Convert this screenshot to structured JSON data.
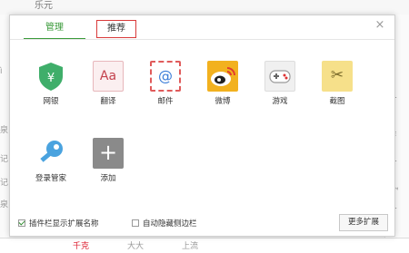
{
  "background": {
    "top_text": "乐元",
    "left_fragments": [
      "ì",
      "泉",
      "记",
      "记",
      "泉"
    ],
    "right_fragments": [
      "‹",
      "T",
      "¥",
      "T",
      "™",
      "T"
    ],
    "bottom_fragments": [
      "千克",
      "大大",
      "上流"
    ]
  },
  "dialog": {
    "tabs": [
      {
        "label": "管理"
      },
      {
        "label": "推荐"
      }
    ],
    "close_glyph": "×",
    "extensions": [
      {
        "name": "网银",
        "icon": "shield-icon",
        "color": "#3fae6a",
        "glyph": "¥"
      },
      {
        "name": "翻译",
        "icon": "translate-icon",
        "color": "#e7e7e7",
        "glyph": "Aa"
      },
      {
        "name": "邮件",
        "icon": "mail-icon",
        "color": "#ffffff",
        "glyph": "@"
      },
      {
        "name": "微博",
        "icon": "weibo-icon",
        "color": "#f2b11f",
        "glyph": ""
      },
      {
        "name": "游戏",
        "icon": "gamepad-icon",
        "color": "#eeeeee",
        "glyph": ""
      },
      {
        "name": "截图",
        "icon": "screenshot-icon",
        "color": "#f6e08a",
        "glyph": "✂"
      },
      {
        "name": "登录管家",
        "icon": "key-icon",
        "color": "#4aa3df",
        "glyph": ""
      },
      {
        "name": "添加",
        "icon": "add-icon",
        "color": "#8a8a8a",
        "glyph": "+"
      }
    ],
    "footer": {
      "show_ext_name_label": "插件栏显示扩展名称",
      "show_ext_name_checked": true,
      "auto_hide_label": "自动隐藏侧边栏",
      "auto_hide_checked": false,
      "more_button_label": "更多扩展"
    }
  }
}
